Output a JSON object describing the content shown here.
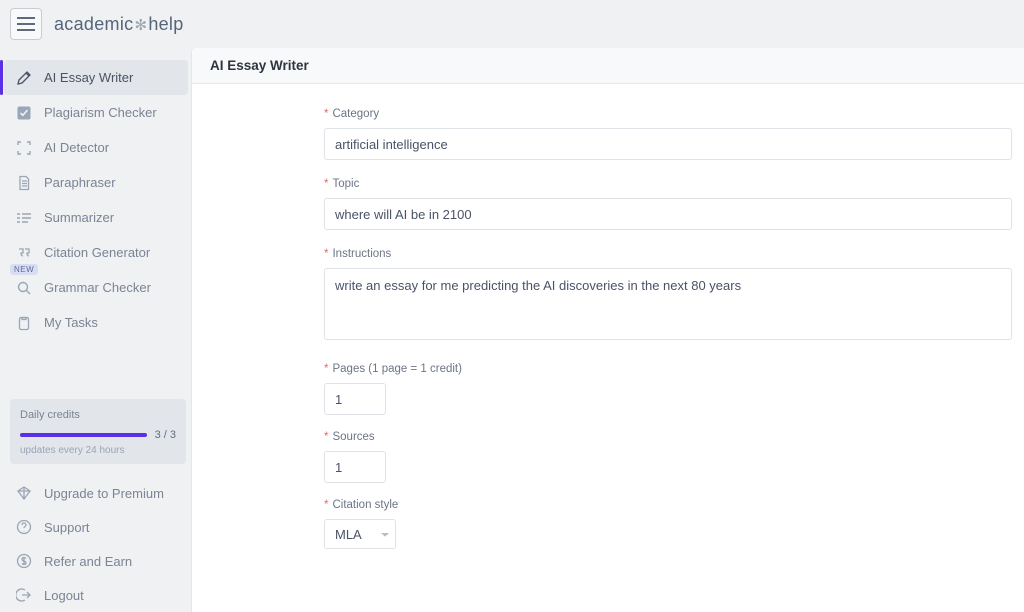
{
  "brand": {
    "part1": "academic",
    "part2": "help"
  },
  "sidebar": {
    "items": [
      {
        "label": "AI Essay Writer"
      },
      {
        "label": "Plagiarism Checker"
      },
      {
        "label": "AI Detector"
      },
      {
        "label": "Paraphraser"
      },
      {
        "label": "Summarizer"
      },
      {
        "label": "Citation Generator"
      },
      {
        "label": "Grammar Checker",
        "badge": "NEW"
      },
      {
        "label": "My Tasks"
      }
    ],
    "credits": {
      "title": "Daily credits",
      "count": "3 / 3",
      "sub": "updates every 24 hours",
      "percent": 100
    },
    "footer": [
      {
        "label": "Upgrade to Premium"
      },
      {
        "label": "Support"
      },
      {
        "label": "Refer and Earn"
      },
      {
        "label": "Logout"
      }
    ]
  },
  "page": {
    "title": "AI Essay Writer"
  },
  "form": {
    "labels": {
      "category": "Category",
      "topic": "Topic",
      "instructions": "Instructions",
      "pages": "Pages (1 page = 1 credit)",
      "sources": "Sources",
      "citation": "Citation style"
    },
    "values": {
      "category": "artificial intelligence",
      "topic": "where will AI be in 2100",
      "instructions": "write an essay for me predicting the AI discoveries in the next 80 years",
      "pages": "1",
      "sources": "1",
      "citation": "MLA"
    }
  }
}
